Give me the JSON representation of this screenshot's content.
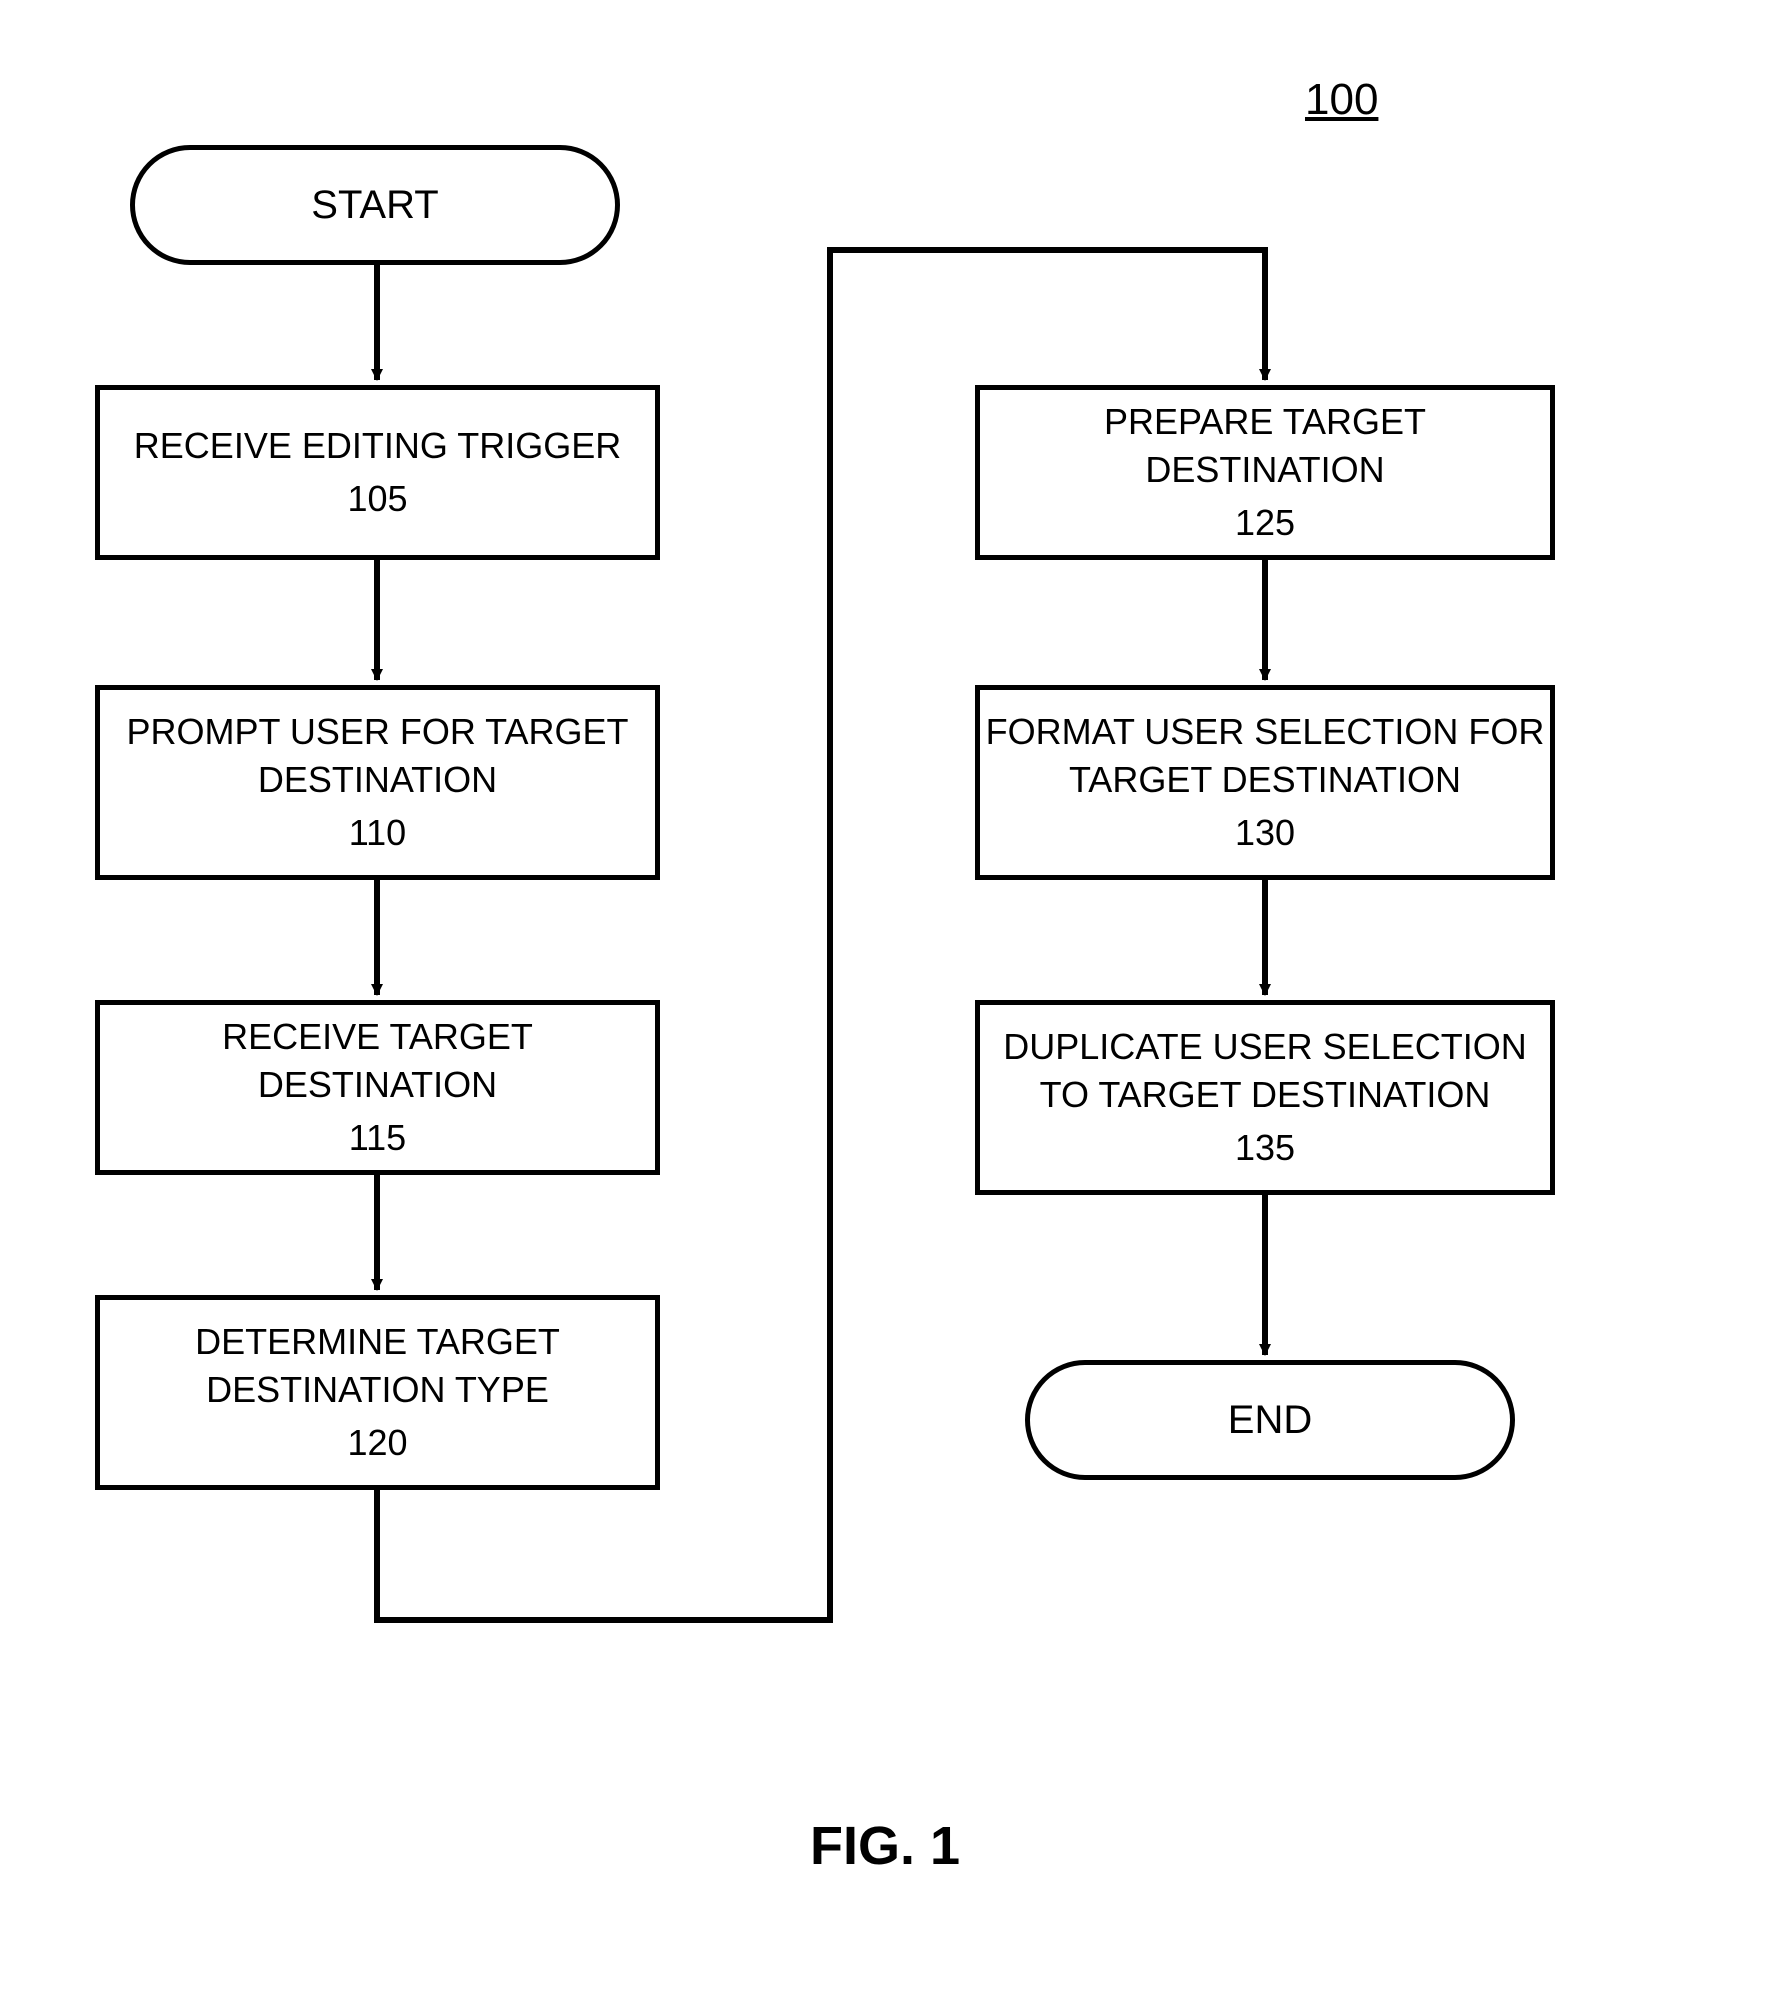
{
  "figureNumber": "100",
  "figureLabel": "FIG. 1",
  "nodes": {
    "start": "START",
    "end": "END",
    "step105": {
      "title": "RECEIVE EDITING TRIGGER",
      "num": "105"
    },
    "step110": {
      "title": "PROMPT USER FOR TARGET DESTINATION",
      "num": "110"
    },
    "step115": {
      "title": "RECEIVE TARGET DESTINATION",
      "num": "115"
    },
    "step120": {
      "title": "DETERMINE TARGET DESTINATION TYPE",
      "num": "120"
    },
    "step125": {
      "title": "PREPARE TARGET DESTINATION",
      "num": "125"
    },
    "step130": {
      "title": "FORMAT USER SELECTION FOR TARGET DESTINATION",
      "num": "130"
    },
    "step135": {
      "title": "DUPLICATE USER SELECTION TO TARGET DESTINATION",
      "num": "135"
    }
  }
}
